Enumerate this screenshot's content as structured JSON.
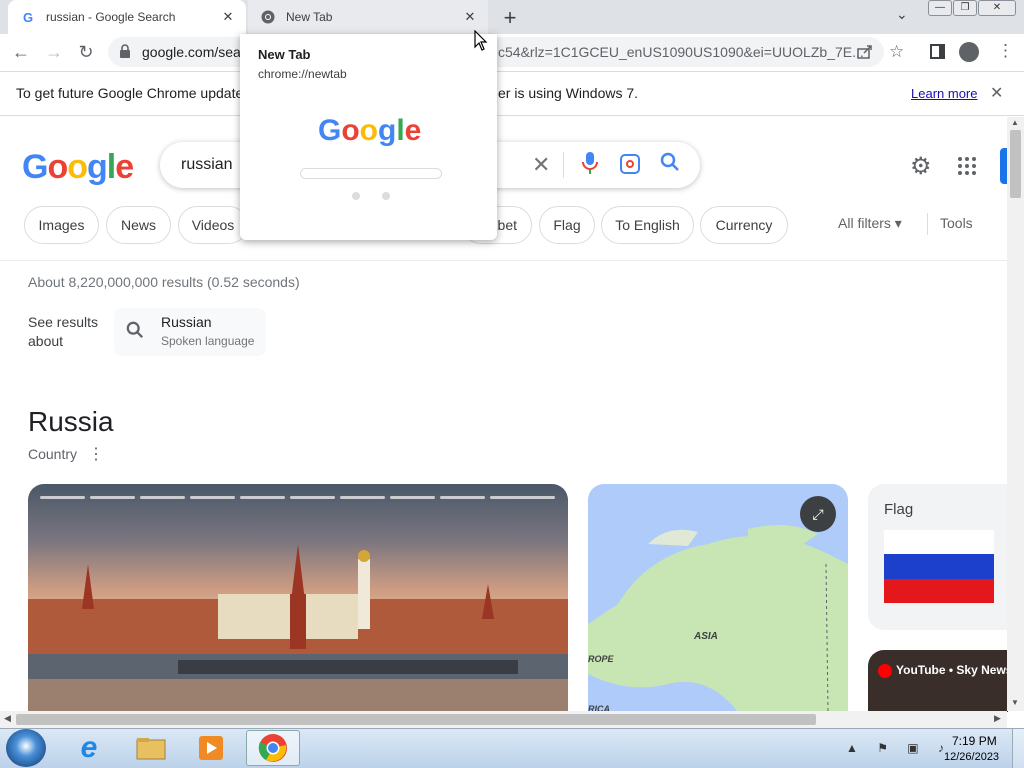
{
  "browser": {
    "tabs": [
      {
        "title": "russian - Google Search",
        "favicon": "google-g-icon",
        "active": true
      },
      {
        "title": "New Tab",
        "favicon": "chrome-icon",
        "active": false
      }
    ],
    "new_tab_symbol": "+",
    "tab_search_symbol": "⌄",
    "window_buttons": {
      "minimize": "—",
      "restore": "❐",
      "close": "✕"
    },
    "nav": {
      "back": "←",
      "forward": "→",
      "reload": "↻"
    },
    "url_start": "google.com/sea",
    "url_end": "c54&rlz=1C1GCEU_enUS1090US1090&ei=UUOLZb_7E...",
    "tab_close_symbol": "✕"
  },
  "infobar": {
    "text_start": "To get future Google Chrome updates,",
    "text_end": "er is using Windows 7.",
    "learn_more": "Learn more",
    "close_symbol": "✕"
  },
  "search": {
    "logo_text": "Google",
    "query": "russian",
    "clear_symbol": "✕",
    "mic_symbol": "🎤",
    "search_symbol": "🔍"
  },
  "chips": [
    "Images",
    "News",
    "Videos",
    "bet",
    "Flag",
    "To English",
    "Currency"
  ],
  "filters": {
    "all_filters": "All filters ▾",
    "tools": "Tools"
  },
  "results": {
    "stats": "About 8,220,000,000 results (0.52 seconds)",
    "see_results_about": "See results about",
    "about_name": "Russian",
    "about_sub": "Spoken language"
  },
  "knowledge_panel": {
    "title": "Russia",
    "subtitle": "Country",
    "more_symbol": "⋮",
    "map_labels": {
      "asia": "ASIA",
      "europe": "ROPE",
      "africa": "RICA"
    },
    "flag_label": "Flag",
    "youtube_label": "YouTube • Sky News",
    "flag_colors": [
      "#ffffff",
      "#1c3fcc",
      "#e4181c"
    ]
  },
  "tab_preview": {
    "title": "New Tab",
    "url": "chrome://newtab",
    "logo_text": "Google"
  },
  "taskbar": {
    "time": "7:19 PM",
    "date": "12/26/2023"
  }
}
